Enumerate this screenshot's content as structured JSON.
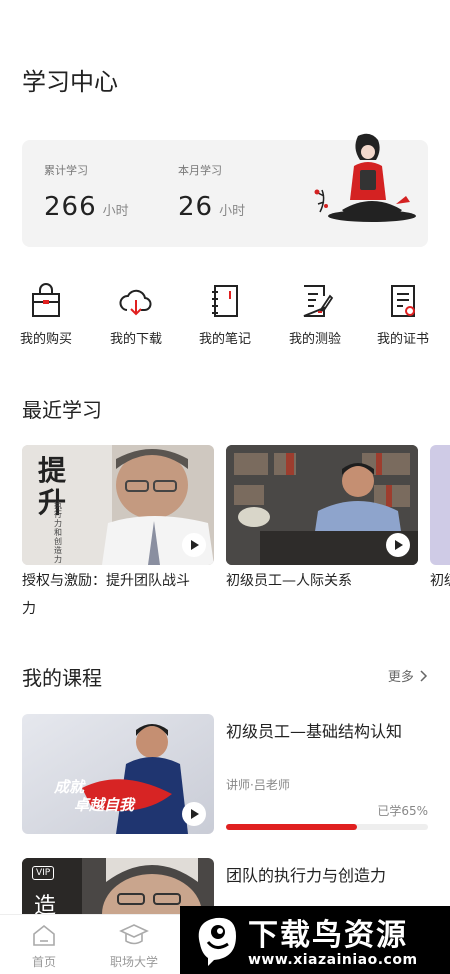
{
  "header": {
    "title": "学习中心"
  },
  "stats": {
    "total": {
      "label": "累计学习",
      "value": "266",
      "unit": "小时"
    },
    "month": {
      "label": "本月学习",
      "value": "26",
      "unit": "小时"
    }
  },
  "actions": [
    {
      "label": "我的购买",
      "icon": "shopping-bag-icon"
    },
    {
      "label": "我的下载",
      "icon": "cloud-download-icon"
    },
    {
      "label": "我的笔记",
      "icon": "notebook-icon"
    },
    {
      "label": "我的测验",
      "icon": "quiz-icon"
    },
    {
      "label": "我的证书",
      "icon": "certificate-icon"
    }
  ],
  "recent": {
    "title": "最近学习",
    "items": [
      {
        "title_line1": "授权与激励：提升团队战斗",
        "title_line2": "力",
        "thumb_text": "提升",
        "thumb_subtext": "执行力和创造力"
      },
      {
        "title_line1": "初级员工—人际关系"
      },
      {
        "title_line1": "初级"
      }
    ]
  },
  "courses": {
    "title": "我的课程",
    "more": "更多",
    "items": [
      {
        "title": "初级员工—基础结构认知",
        "teacher": "讲师·吕老师",
        "progress_label": "已学65%",
        "progress": 0.65,
        "thumb_quote_line1": "成就",
        "thumb_quote_line2": "卓越自我"
      },
      {
        "title": "团队的执行力与创造力",
        "badge": "VIP",
        "thumb_text": "造"
      }
    ]
  },
  "tabs": [
    {
      "label": "首页",
      "icon": "home-icon"
    },
    {
      "label": "职场大学",
      "icon": "graduation-cap-icon"
    }
  ],
  "watermark": {
    "title": "下载鸟资源",
    "url": "www.xiazainiao.com"
  },
  "colors": {
    "accent": "#e02020",
    "card_bg": "#f3f3f3",
    "text": "#222222"
  }
}
